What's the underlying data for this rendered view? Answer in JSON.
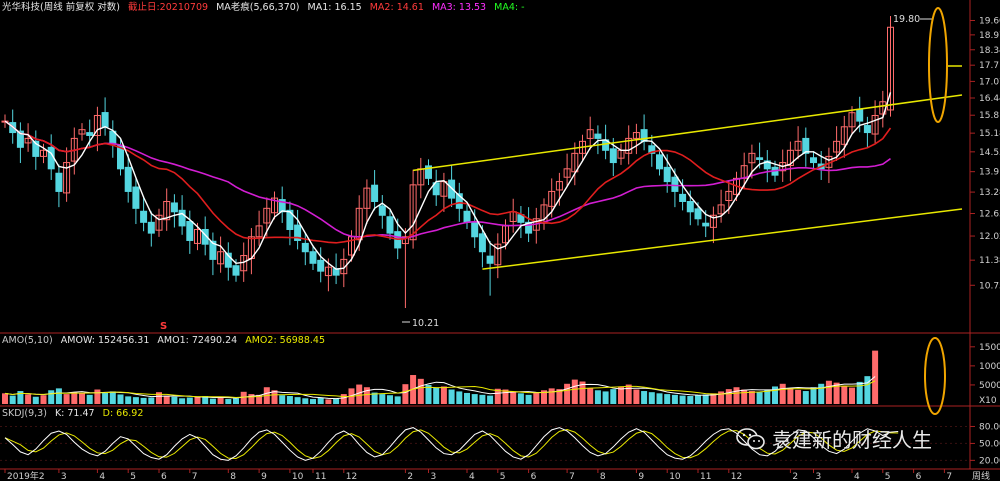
{
  "header": {
    "stock": "光华科技(周线 前复权 对数)",
    "cutoff": "截止日:20210709",
    "ma_group": "MA老痕(5,66,370)",
    "ma1": "MA1: 16.15",
    "ma2": "MA2: 14.61",
    "ma3": "MA3: 13.53",
    "ma4": "MA4: -"
  },
  "price_axis": {
    "labels": [
      "19.60",
      "18.97",
      "18.34",
      "17.71",
      "17.07",
      "16.44",
      "15.81",
      "15.18",
      "14.55",
      "13.91",
      "13.28",
      "12.65",
      "12.02",
      "11.38",
      "10.75"
    ]
  },
  "annotations": {
    "high": "19.80",
    "low": "10.21",
    "marker": "S"
  },
  "amo_panel": {
    "title": "AMO(5,10)",
    "amow": "AMOW: 152456.31",
    "amo1": "AMO1: 72490.24",
    "amo2": "AMO2: 56988.45",
    "axis": [
      "15000",
      "10000",
      "5000"
    ],
    "unit": "X10"
  },
  "kdj_panel": {
    "title": "SKDJ(9,3)",
    "k": "K: 71.47",
    "d": "D: 66.92",
    "axis": [
      "80.00",
      "50.00",
      "20.00"
    ]
  },
  "time_axis": {
    "labels": [
      {
        "text": "2019年2",
        "i": 0
      },
      {
        "text": "3",
        "i": 7
      },
      {
        "text": "4",
        "i": 12
      },
      {
        "text": "5",
        "i": 16
      },
      {
        "text": "6",
        "i": 20
      },
      {
        "text": "7",
        "i": 24
      },
      {
        "text": "8",
        "i": 29
      },
      {
        "text": "9",
        "i": 33
      },
      {
        "text": "10",
        "i": 37
      },
      {
        "text": "11",
        "i": 40
      },
      {
        "text": "12",
        "i": 44
      },
      {
        "text": "2",
        "i": 52
      },
      {
        "text": "3",
        "i": 55
      },
      {
        "text": "4",
        "i": 60
      },
      {
        "text": "5",
        "i": 64
      },
      {
        "text": "6",
        "i": 68
      },
      {
        "text": "7",
        "i": 73
      },
      {
        "text": "8",
        "i": 77
      },
      {
        "text": "9",
        "i": 82
      },
      {
        "text": "10",
        "i": 86
      },
      {
        "text": "11",
        "i": 90
      },
      {
        "text": "12",
        "i": 94
      },
      {
        "text": "2",
        "i": 102
      },
      {
        "text": "3",
        "i": 105
      },
      {
        "text": "4",
        "i": 110
      },
      {
        "text": "5",
        "i": 114
      },
      {
        "text": "6",
        "i": 118
      },
      {
        "text": "7",
        "i": 122
      }
    ],
    "period": "周线"
  },
  "watermark": {
    "text": "袁建新的财经人生",
    "icon": "wechat-icon"
  },
  "colors": {
    "up": "#ff6b6b",
    "down": "#54d6e0",
    "ma1": "#ffffff",
    "ma2": "#e01e1e",
    "ma3": "#d21ed2",
    "channel": "#e8e800",
    "highlight": "#f0a500"
  },
  "chart_data": {
    "type": "candlestick",
    "y_scale": "log",
    "ylim": [
      10.21,
      19.8
    ],
    "closes": [
      15.6,
      15.2,
      14.7,
      15.0,
      14.4,
      14.6,
      14.0,
      13.3,
      14.2,
      15.0,
      15.3,
      15.1,
      15.8,
      15.4,
      14.8,
      14.0,
      13.3,
      12.8,
      12.4,
      12.1,
      12.6,
      13.0,
      12.7,
      12.3,
      11.9,
      12.2,
      11.8,
      11.4,
      11.6,
      11.2,
      11.0,
      11.5,
      12.0,
      12.3,
      12.8,
      13.1,
      12.7,
      12.2,
      11.9,
      11.6,
      11.3,
      11.1,
      11.2,
      11.0,
      11.4,
      12.0,
      12.8,
      13.4,
      13.0,
      12.6,
      12.1,
      11.7,
      12.0,
      13.5,
      14.0,
      13.7,
      13.2,
      13.6,
      13.1,
      12.8,
      12.4,
      12.0,
      11.6,
      11.3,
      11.8,
      12.3,
      12.7,
      12.4,
      12.1,
      12.5,
      12.9,
      13.3,
      13.6,
      14.0,
      14.5,
      14.9,
      15.3,
      15.0,
      14.6,
      14.2,
      14.6,
      15.0,
      15.2,
      14.9,
      14.5,
      14.0,
      13.6,
      13.3,
      13.0,
      12.7,
      12.5,
      12.3,
      12.6,
      12.9,
      13.3,
      13.7,
      14.1,
      14.5,
      14.3,
      14.0,
      13.8,
      14.2,
      14.6,
      14.9,
      14.5,
      14.2,
      14.0,
      14.4,
      14.9,
      15.4,
      15.9,
      15.6,
      15.2,
      15.8,
      16.3,
      19.3
    ],
    "volumes": [
      2800,
      2200,
      3400,
      2500,
      1900,
      2300,
      3600,
      4100,
      2600,
      3000,
      2900,
      2400,
      3800,
      3100,
      3300,
      2500,
      2000,
      1800,
      1600,
      1700,
      3100,
      2200,
      1900,
      1500,
      1700,
      1900,
      2100,
      1400,
      1600,
      1300,
      1500,
      3200,
      2600,
      2400,
      4400,
      3600,
      2300,
      2100,
      1800,
      1500,
      1300,
      1600,
      1200,
      1400,
      2600,
      4100,
      5100,
      4400,
      3000,
      2600,
      2300,
      2000,
      5200,
      7600,
      6600,
      5000,
      4200,
      4600,
      3800,
      3300,
      2900,
      2600,
      2400,
      2200,
      4000,
      3800,
      3300,
      2800,
      2400,
      3000,
      3600,
      4100,
      3900,
      5300,
      6400,
      5900,
      4200,
      3600,
      3300,
      3900,
      4600,
      5100,
      3800,
      3400,
      3100,
      2800,
      2600,
      2400,
      2200,
      2100,
      2300,
      2500,
      2800,
      3300,
      3900,
      4400,
      3800,
      3400,
      3100,
      3800,
      4600,
      5300,
      4200,
      3700,
      3400,
      4400,
      5300,
      6100,
      5600,
      4700,
      4300,
      5800,
      7300,
      14000
    ],
    "k": [
      60,
      48,
      35,
      30,
      40,
      55,
      68,
      72,
      66,
      52,
      40,
      32,
      28,
      36,
      50,
      62,
      58,
      45,
      32,
      25,
      22,
      30,
      45,
      58,
      66,
      60,
      45,
      30,
      22,
      20,
      28,
      42,
      58,
      70,
      74,
      66,
      52,
      38,
      26,
      20,
      24,
      36,
      52,
      66,
      72,
      64,
      48,
      34,
      26,
      30,
      44,
      60,
      74,
      78,
      70,
      56,
      42,
      32,
      30,
      38,
      52,
      66,
      72,
      64,
      50,
      36,
      26,
      22,
      30,
      46,
      62,
      74,
      78,
      72,
      60,
      46,
      34,
      28,
      32,
      44,
      58,
      70,
      76,
      70,
      56,
      42,
      30,
      24,
      22,
      28,
      40,
      54,
      66,
      74,
      76,
      68,
      54,
      40,
      30,
      28,
      36,
      50,
      64,
      74,
      72,
      60,
      46,
      36,
      32,
      40,
      54,
      68,
      76,
      72,
      64,
      70,
      71
    ]
  }
}
